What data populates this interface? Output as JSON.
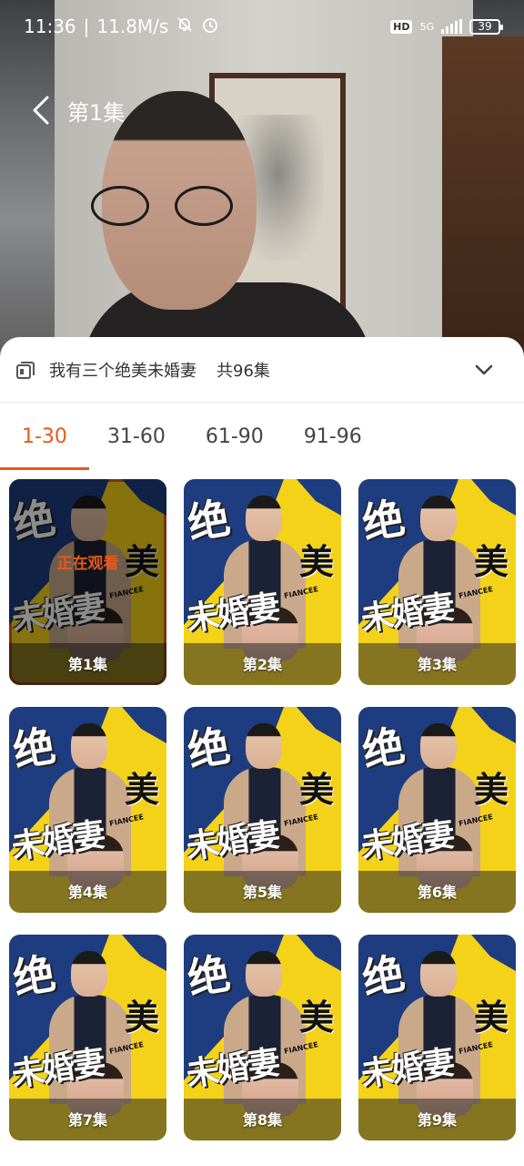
{
  "status_bar": {
    "time": "11:36",
    "speed": "11.8M/s",
    "hd": "HD",
    "network": "5G",
    "battery": "39"
  },
  "nav": {
    "title": "第1集"
  },
  "series": {
    "title": "我有三个绝美未婚妻",
    "count": "共96集"
  },
  "tabs": [
    {
      "label": "1-30",
      "active": true
    },
    {
      "label": "31-60",
      "active": false
    },
    {
      "label": "61-90",
      "active": false
    },
    {
      "label": "91-96",
      "active": false
    }
  ],
  "poster_text": {
    "c1": "绝",
    "c2": "美",
    "c3": "未婚妻",
    "fiancee": "FIANCEE"
  },
  "now_watching": "正在观看",
  "episodes": [
    "第1集",
    "第2集",
    "第3集",
    "第4集",
    "第5集",
    "第6集",
    "第7集",
    "第8集",
    "第9集"
  ],
  "current_episode_index": 0,
  "colors": {
    "accent": "#e6591c",
    "poster_yellow": "#f5d21a",
    "poster_blue": "#1e3d80"
  }
}
